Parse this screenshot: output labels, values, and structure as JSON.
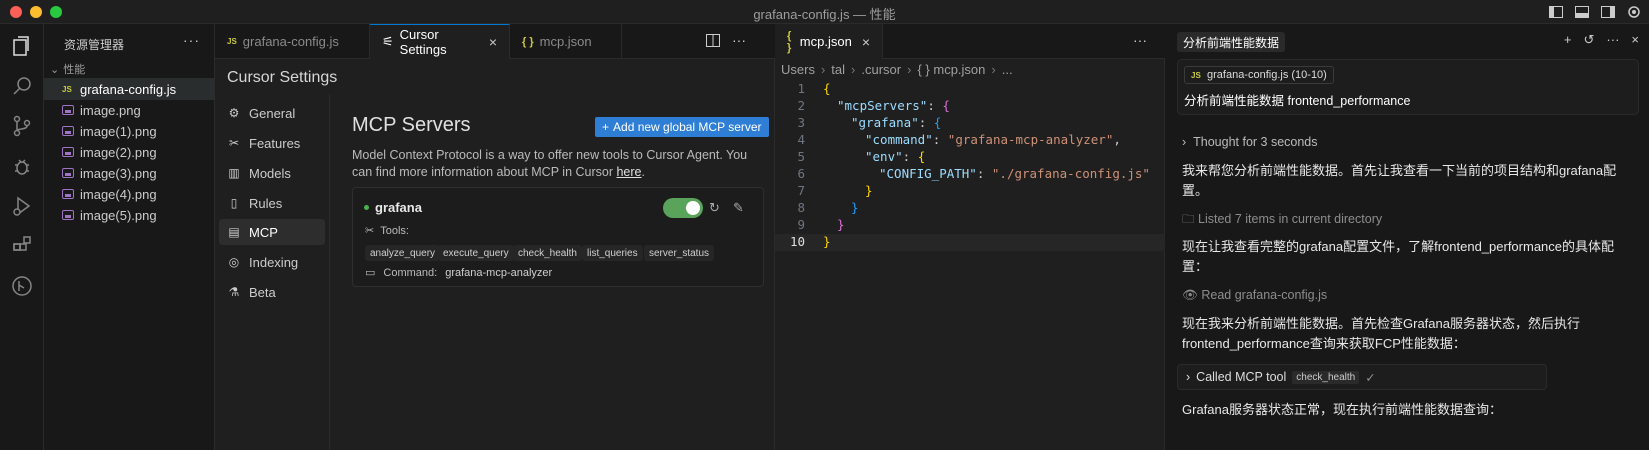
{
  "window": {
    "title": "grafana-config.js — 性能"
  },
  "explorer": {
    "title": "资源管理器",
    "folder": "性能",
    "files": [
      {
        "name": "grafana-config.js",
        "type": "js"
      },
      {
        "name": "image.png",
        "type": "img"
      },
      {
        "name": "image(1).png",
        "type": "img"
      },
      {
        "name": "image(2).png",
        "type": "img"
      },
      {
        "name": "image(3).png",
        "type": "img"
      },
      {
        "name": "image(4).png",
        "type": "img"
      },
      {
        "name": "image(5).png",
        "type": "img"
      }
    ]
  },
  "tabs_left": {
    "tab1": "grafana-config.js",
    "tab2": "Cursor Settings",
    "tab3": "mcp.json",
    "js_badge": "JS",
    "json_badge": "{ }"
  },
  "tabs_right": {
    "tab1": "mcp.json"
  },
  "settings": {
    "title": "Cursor Settings",
    "nav": [
      "General",
      "Features",
      "Models",
      "Rules",
      "MCP",
      "Indexing",
      "Beta"
    ],
    "mcp_title": "MCP Servers",
    "add_button": "Add new global MCP server",
    "desc": "Model Context Protocol is a way to offer new tools to Cursor Agent. You can find more information about MCP in Cursor ",
    "desc_link": "here",
    "desc_end": ".",
    "server": {
      "name": "grafana",
      "tools_label": "Tools:",
      "tools": [
        "analyze_query",
        "execute_query",
        "check_health",
        "list_queries",
        "server_status"
      ],
      "command_label": "Command:",
      "command": "grafana-mcp-analyzer",
      "enabled": true
    }
  },
  "editor": {
    "breadcrumb": [
      "Users",
      "tal",
      ".cursor",
      "{ } mcp.json",
      "..."
    ],
    "line_numbers": [
      "1",
      "2",
      "3",
      "4",
      "5",
      "6",
      "7",
      "8",
      "9",
      "10"
    ],
    "lines": {
      "l1": "{",
      "l2k": "\"mcpServers\"",
      "l2b": "{",
      "l3k": "\"grafana\"",
      "l3b": "{",
      "l4k": "\"command\"",
      "l4v": "\"grafana-mcp-analyzer\"",
      "l5k": "\"env\"",
      "l5b": "{",
      "l6k": "\"CONFIG_PATH\"",
      "l6v": "\"./grafana-config.js\"",
      "l7": "}",
      "l8": "}",
      "l9": "}",
      "l10": "}"
    }
  },
  "chat": {
    "tab_title": "分析前端性能数据",
    "context_file": "grafana-config.js (10-10)",
    "context_text": "分析前端性能数据 frontend_performance",
    "thought": "Thought for 3 seconds",
    "msg1": "我来帮您分析前端性能数据。首先让我查看一下当前的项目结构和grafana配置。",
    "listed": "Listed 7 items in current directory",
    "msg2": "现在让我查看完整的grafana配置文件，了解frontend_performance的具体配置：",
    "read": "Read grafana-config.js",
    "msg3": "现在我来分析前端性能数据。首先检查Grafana服务器状态，然后执行frontend_performance查询来获取FCP性能数据：",
    "tool_call_label": "Called MCP tool",
    "tool_call_name": "check_health",
    "msg4": "Grafana服务器状态正常，现在执行前端性能数据查询："
  }
}
